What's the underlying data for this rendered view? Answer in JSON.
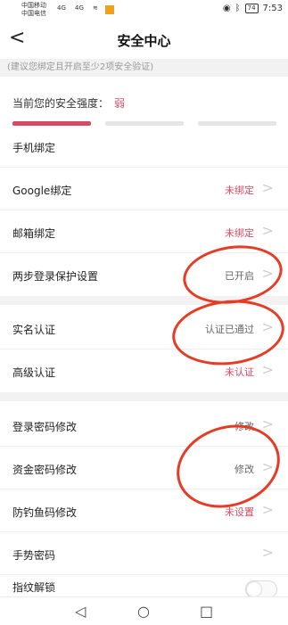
{
  "status_bar": {
    "carrier1": "中国移动",
    "carrier2": "中国电信",
    "signal1": "4G",
    "signal2": "4G",
    "battery": "74",
    "time": "7:53"
  },
  "header": {
    "back_icon": "chevron-left-icon",
    "title": "安全中心"
  },
  "tip": "(建议您绑定且开启至少2项安全验证)",
  "strength": {
    "label": "当前您的安全强度：",
    "value": "弱",
    "level_fraction": 0.333
  },
  "colors": {
    "accent": "#d64b63",
    "annotation": "#e63c26"
  },
  "rows": [
    {
      "label": "手机绑定",
      "status": ""
    },
    {
      "label": "Google绑定",
      "status": "未绑定"
    },
    {
      "label": "邮箱绑定",
      "status": "未绑定"
    },
    {
      "label": "两步登录保护设置",
      "status": "已开启"
    },
    {
      "label": "实名认证",
      "status": "认证已通过"
    },
    {
      "label": "高级认证",
      "status": "未认证"
    },
    {
      "label": "登录密码修改",
      "status": "修改"
    },
    {
      "label": "资金密码修改",
      "status": "修改"
    },
    {
      "label": "防钓鱼码修改",
      "status": "未设置"
    },
    {
      "label": "手势密码",
      "status": ""
    },
    {
      "label": "指纹解锁",
      "status": ""
    }
  ],
  "system_nav": {
    "back": "◁",
    "home": "○",
    "recent": "□"
  }
}
